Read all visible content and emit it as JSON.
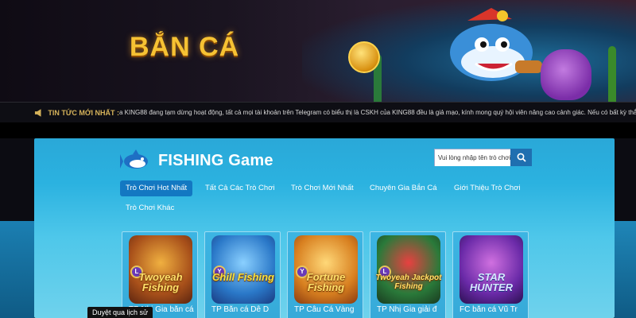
{
  "banner": {
    "title": "BẮN CÁ"
  },
  "ticker": {
    "label": "TIN TỨC MỚI NHẤT :",
    "text": "a KING88 đang tạm dừng hoạt động, tất cả mọi tài khoản trên Telegram có biểu thị là CSKH của KING88 đều là giả mạo, kính mong quý hội viên nâng cao cảnh giác. Nếu có bất kỳ thắc mắ"
  },
  "section": {
    "logo_text": "FISHING Game"
  },
  "search": {
    "placeholder": "Vui lòng nhập tên trò chơi."
  },
  "nav": {
    "items": [
      {
        "label": "Trò Chơi Hot Nhất",
        "active": true
      },
      {
        "label": "Tất Cả Các Trò Chơi"
      },
      {
        "label": "Trò Chơi Mới Nhất"
      },
      {
        "label": "Chuyên Gia Bắn Cá"
      },
      {
        "label": "Giới Thiệu Trò Chơi"
      },
      {
        "label": "Trò Chơi Khác"
      }
    ]
  },
  "games": [
    {
      "name": "TP Nhị Gia bắn cá",
      "logo": "Twoyeah Fishing",
      "badge": "L"
    },
    {
      "name": "TP Bắn cá Dễ D",
      "logo": "Chill Fishing",
      "badge": "Y"
    },
    {
      "name": "TP Câu Cá Vàng",
      "logo": "Fortune Fishing",
      "badge": "Y"
    },
    {
      "name": "TP Nhị Gia giải đ",
      "logo": "Twoyeah Jackpot Fishing",
      "badge": "L"
    },
    {
      "name": "FC bắn cá Vũ Tr",
      "logo": "STAR HUNTER",
      "badge": ""
    }
  ],
  "tooltip": {
    "text": "Duyệt qua lịch sử"
  },
  "colors": {
    "accent": "#1378c2",
    "title_gold": "#f6c233",
    "panel": "#2bb2e0"
  }
}
